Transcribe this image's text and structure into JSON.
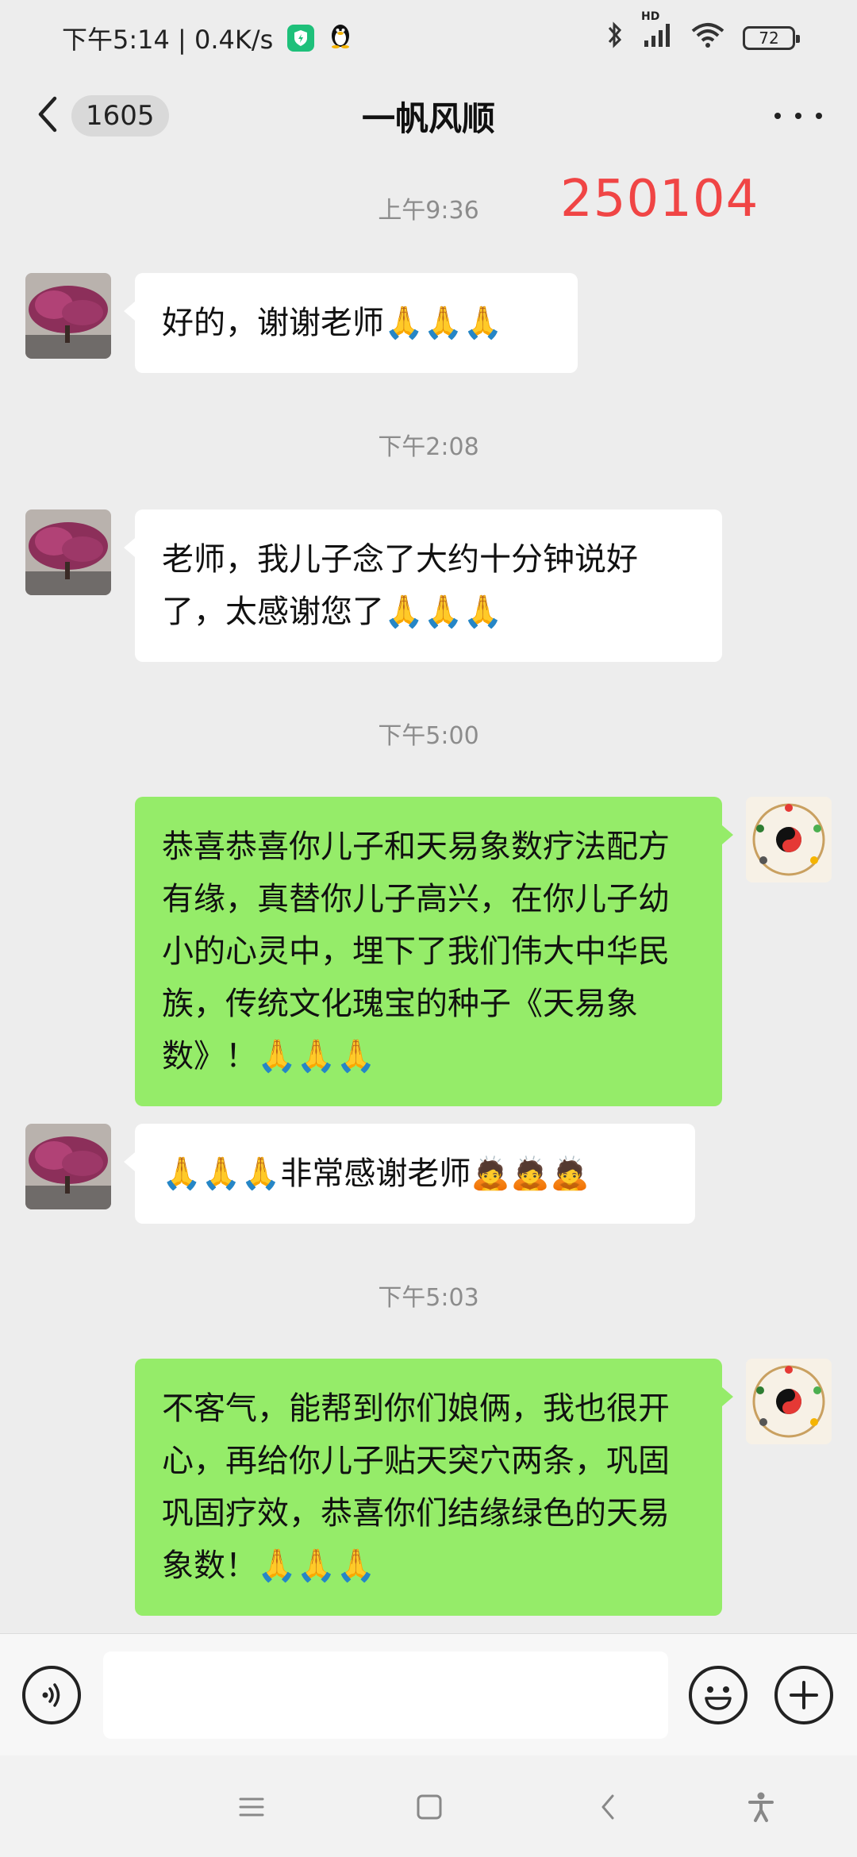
{
  "status_bar": {
    "time_speed": "下午5:14 | 0.4K/s",
    "network_label": "HD",
    "battery": "72"
  },
  "title_bar": {
    "unread_count": "1605",
    "title": "一帆风顺"
  },
  "annotation": "250104",
  "messages": [
    {
      "timestamp": "上午9:36"
    },
    {
      "side": "in",
      "text": "好的，谢谢老师🙏🙏🙏"
    },
    {
      "timestamp": "下午2:08"
    },
    {
      "side": "in",
      "text": "老师，我儿子念了大约十分钟说好了，太感谢您了🙏🙏🙏"
    },
    {
      "timestamp": "下午5:00"
    },
    {
      "side": "out",
      "text": "恭喜恭喜你儿子和天易象数疗法配方有缘，真替你儿子高兴，在你儿子幼小的心灵中，埋下了我们伟大中华民族，传统文化瑰宝的种子《天易象数》！🙏🙏🙏"
    },
    {
      "side": "in",
      "text": "🙏🙏🙏非常感谢老师🙇🙇🙇"
    },
    {
      "timestamp": "下午5:03"
    },
    {
      "side": "out",
      "text": "不客气，能帮到你们娘俩，我也很开心，再给你儿子贴天突穴两条，巩固巩固疗效，恭喜你们结缘绿色的天易象数！🙏🙏🙏"
    }
  ],
  "input": {
    "placeholder": ""
  },
  "colors": {
    "background": "#ededed",
    "outgoing_bubble": "#95ec69",
    "incoming_bubble": "#ffffff",
    "annotation": "#f04545"
  }
}
